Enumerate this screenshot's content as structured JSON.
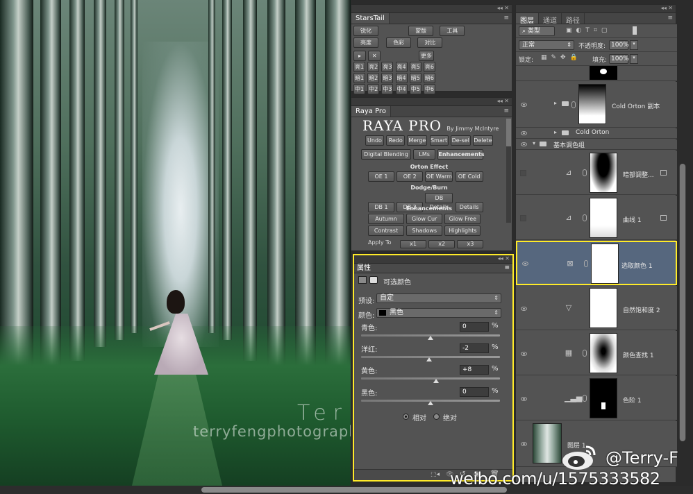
{
  "watermark": {
    "name": "Terry F",
    "url": "terryfengphotography.lofter.com"
  },
  "starstail": {
    "title": "StarsTail",
    "row1": [
      "锐化",
      "蒙版",
      "工具"
    ],
    "row2": [
      "亮度",
      "色彩",
      "对比"
    ],
    "row3_right": "更多",
    "row4": [
      "亮1",
      "亮2",
      "亮3",
      "亮4",
      "亮5",
      "亮6"
    ],
    "row5": [
      "暗1",
      "暗2",
      "暗3",
      "暗4",
      "暗5",
      "暗6"
    ],
    "row6": [
      "中1",
      "中2",
      "中3",
      "中4",
      "中5",
      "中6"
    ]
  },
  "raya": {
    "title": "Raya Pro",
    "logo": "RAYA PRO",
    "by": "By Jimmy McIntyre",
    "top_buttons": [
      "Undo",
      "Redo",
      "Merge",
      "Smart",
      "De-sel",
      "Delete"
    ],
    "tabs": [
      "Digital Blending",
      "LMs",
      "Enhancements"
    ],
    "orton_title": "Orton Effect",
    "orton": [
      "OE 1",
      "OE 2",
      "OE Warm",
      "OE Cold"
    ],
    "dodge_title": "Dodge/Burn",
    "dodge": [
      "DB 1",
      "DB 2",
      "DB Details",
      "Details"
    ],
    "enh_title": "Enhancements",
    "enh_row1": [
      "Autumn",
      "Glow Cur",
      "Glow Free"
    ],
    "enh_row2": [
      "Contrast",
      "Shadows",
      "Highlights"
    ],
    "apply_to": "Apply To",
    "apply": [
      "x1",
      "x2",
      "x3"
    ]
  },
  "properties": {
    "title": "属性",
    "type_label": "可选颜色",
    "preset_label": "预设:",
    "preset_value": "自定",
    "color_label": "颜色:",
    "color_value": "黑色",
    "sliders": [
      {
        "label": "青色:",
        "value": "0",
        "unit": "%",
        "pos": 0.5
      },
      {
        "label": "洋红:",
        "value": "-2",
        "unit": "%",
        "pos": 0.49
      },
      {
        "label": "黄色:",
        "value": "+8",
        "unit": "%",
        "pos": 0.54
      },
      {
        "label": "黑色:",
        "value": "0",
        "unit": "%",
        "pos": 0.5
      }
    ],
    "radio_relative": "相对",
    "radio_absolute": "绝对"
  },
  "layers": {
    "tabs": [
      "图层",
      "通道",
      "路径"
    ],
    "filter_kind": "类型",
    "blend_mode": "正常",
    "opacity_label": "不透明度:",
    "opacity_value": "100%",
    "lock_label": "锁定:",
    "fill_label": "填充:",
    "fill_value": "100%",
    "items": [
      {
        "name": "Cold Orton 副本"
      },
      {
        "name": "Cold Orton"
      },
      {
        "name": "基本调色组"
      },
      {
        "name": "暗部调整..."
      },
      {
        "name": "曲线 1"
      },
      {
        "name": "选取颜色 1"
      },
      {
        "name": "自然饱和度 2"
      },
      {
        "name": "颜色查找 1"
      },
      {
        "name": "色阶 1"
      },
      {
        "name": "图层 1"
      }
    ]
  },
  "weibo": {
    "handle": "@Terry-F",
    "url": "weibo.com/u/1575333582"
  }
}
